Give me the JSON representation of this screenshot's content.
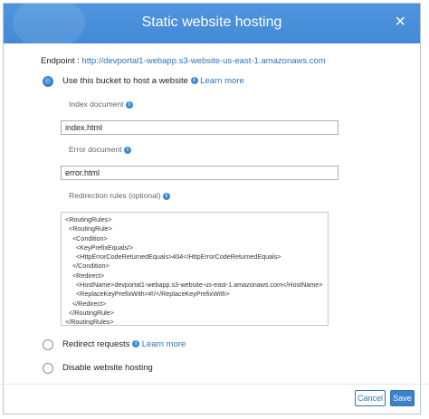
{
  "dialog": {
    "title": "Static website hosting",
    "close_glyph": "×"
  },
  "endpoint": {
    "label": "Endpoint : ",
    "url": "http://devportal1-webapp.s3-website-us-east-1.amazonaws.com"
  },
  "options": {
    "host": {
      "label": "Use this bucket to host a website",
      "link": "Learn more",
      "selected": true
    },
    "redirect": {
      "label": "Redirect requests",
      "link": "Learn more",
      "selected": false
    },
    "disable": {
      "label": "Disable website hosting",
      "selected": false
    }
  },
  "fields": {
    "index": {
      "label": "Index document",
      "value": "index.html"
    },
    "error": {
      "label": "Error document",
      "value": "error.html"
    },
    "redirection": {
      "label": "Redirection rules (optional)",
      "value": "<RoutingRules>\n  <RoutingRule>\n    <Condition>\n      <KeyPrefixEquals/>\n      <HttpErrorCodeReturnedEquals>404</HttpErrorCodeReturnedEquals>\n    </Condition>\n    <Redirect>\n      <HostName>devportal1-webapp.s3-website-us-east-1.amazonaws.com</HostName>\n      <ReplaceKeyPrefixWith>#!/</ReplaceKeyPrefixWith>\n    </Redirect>\n  </RoutingRule>\n</RoutingRules>"
    }
  },
  "info_glyph": "i",
  "buttons": {
    "cancel": "Cancel",
    "save": "Save"
  },
  "colors": {
    "header": "#4a90d9",
    "accent": "#2e73b8"
  }
}
